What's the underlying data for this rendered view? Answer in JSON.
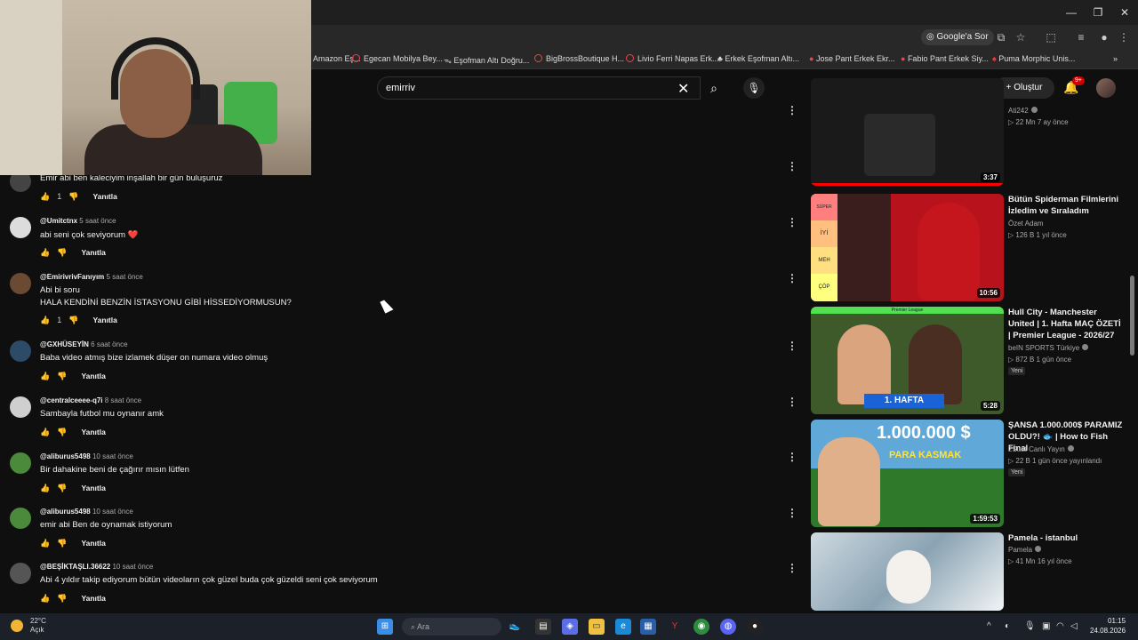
{
  "browser": {
    "google_ask": "Google'a Sor",
    "bookmarks": [
      {
        "label": "Amazon Eş..."
      },
      {
        "label": "Egecan Mobilya Bey..."
      },
      {
        "label": "Eşofman Altı Doğru..."
      },
      {
        "label": "BigBrossBoutique H..."
      },
      {
        "label": "Livio Ferri Napas Erk..."
      },
      {
        "label": "Erkek Eşofman Altı..."
      },
      {
        "label": "Jose Pant Erkek Ekr..."
      },
      {
        "label": "Fabio Pant Erkek Siy..."
      },
      {
        "label": "Puma Morphic Unis..."
      }
    ]
  },
  "youtube": {
    "search_query": "emirriv",
    "create_label": "Oluştur",
    "notif_badge": "9+"
  },
  "comments": [
    {
      "user": "",
      "time": "",
      "text": "Emir abi ben kaleciyim inşallah bir gün buluşuruz",
      "likes": "1",
      "reply": "Yanıtla"
    },
    {
      "user": "@Umitctnx",
      "time": "5 saat önce",
      "text": "abi seni çok seviyorum ❤️",
      "likes": "",
      "reply": "Yanıtla"
    },
    {
      "user": "@EmirivrivFanıyım",
      "time": "5 saat önce",
      "text": "Abi bi soru",
      "text2": "HALA KENDİNİ BENZİN İSTASYONU GİBİ HİSSEDİYORMUSUN?",
      "likes": "1",
      "reply": "Yanıtla"
    },
    {
      "user": "@GXHÜSEYİN",
      "time": "6 saat önce",
      "text": "Baba video atmış bize izlamek düşer on numara video olmuş",
      "likes": "",
      "reply": "Yanıtla"
    },
    {
      "user": "@centralceeee-q7i",
      "time": "8 saat önce",
      "text": "Sambayla futbol mu oynanır amk",
      "likes": "",
      "reply": "Yanıtla"
    },
    {
      "user": "@aliburus5498",
      "time": "10 saat önce",
      "text": "Bir dahakine beni de çağırır mısın lütfen",
      "likes": "",
      "reply": "Yanıtla"
    },
    {
      "user": "@aliburus5498",
      "time": "10 saat önce",
      "text": "emir abi Ben de oynamak istiyorum",
      "likes": "",
      "reply": "Yanıtla"
    },
    {
      "user": "@BEŞİKTAŞLI.36622",
      "time": "10 saat önce",
      "text": "Abi 4 yıldır takip ediyorum bütün videoların çok güzel buda çok güzeldi seni çok seviyorum",
      "likes": "",
      "reply": "Yanıtla"
    }
  ],
  "videos": [
    {
      "title": "",
      "channel": "Ati242",
      "meta": "22 Mn  7 ay önce",
      "duration": "3:37",
      "badge": "",
      "thumb_color": "#1a1a1a"
    },
    {
      "title": "Bütün Spiderman Filmlerini İzledim ve Sıraladım",
      "channel": "Özet Adam",
      "meta": "126 B  1 yıl önce",
      "duration": "10:56",
      "badge": "",
      "thumb_color": "#b8121d"
    },
    {
      "title": "Hull City - Manchester United | 1. Hafta MAÇ ÖZETİ | Premier League - 2026/27",
      "channel": "beIN SPORTS Türkiye",
      "meta": "872 B  1 gün önce",
      "duration": "5:28",
      "badge": "Yeni",
      "thumb_color": "#3f5a2a"
    },
    {
      "title": "ŞANSA 1.000.000$ PARAMIZ OLDU?! 🐟 | How to Fish Final",
      "channel": "2Suat Canlı Yayın",
      "meta": "22 B  1 gün önce yayınlandı",
      "duration": "1:59:53",
      "badge": "Yeni",
      "thumb_color": "#2e7a2a"
    },
    {
      "title": "Pamela - istanbul",
      "channel": "Pamela",
      "meta": "41 Mn  16 yıl önce",
      "duration": "",
      "badge": "",
      "thumb_color": "#c9d4dc"
    }
  ],
  "thumb_texts": {
    "spiderman_tiers": [
      "SÜPER",
      "İYİ",
      "MEH",
      "ÇÖP"
    ],
    "premier": "Premier League",
    "hafta": "1. HAFTA",
    "million": "1.000.000 $",
    "kasmak": "PARA KASMAK"
  },
  "taskbar": {
    "temp": "22°C",
    "weather": "Açık",
    "search_placeholder": "Ara",
    "time": "01:15",
    "date": "24.08.2026"
  }
}
